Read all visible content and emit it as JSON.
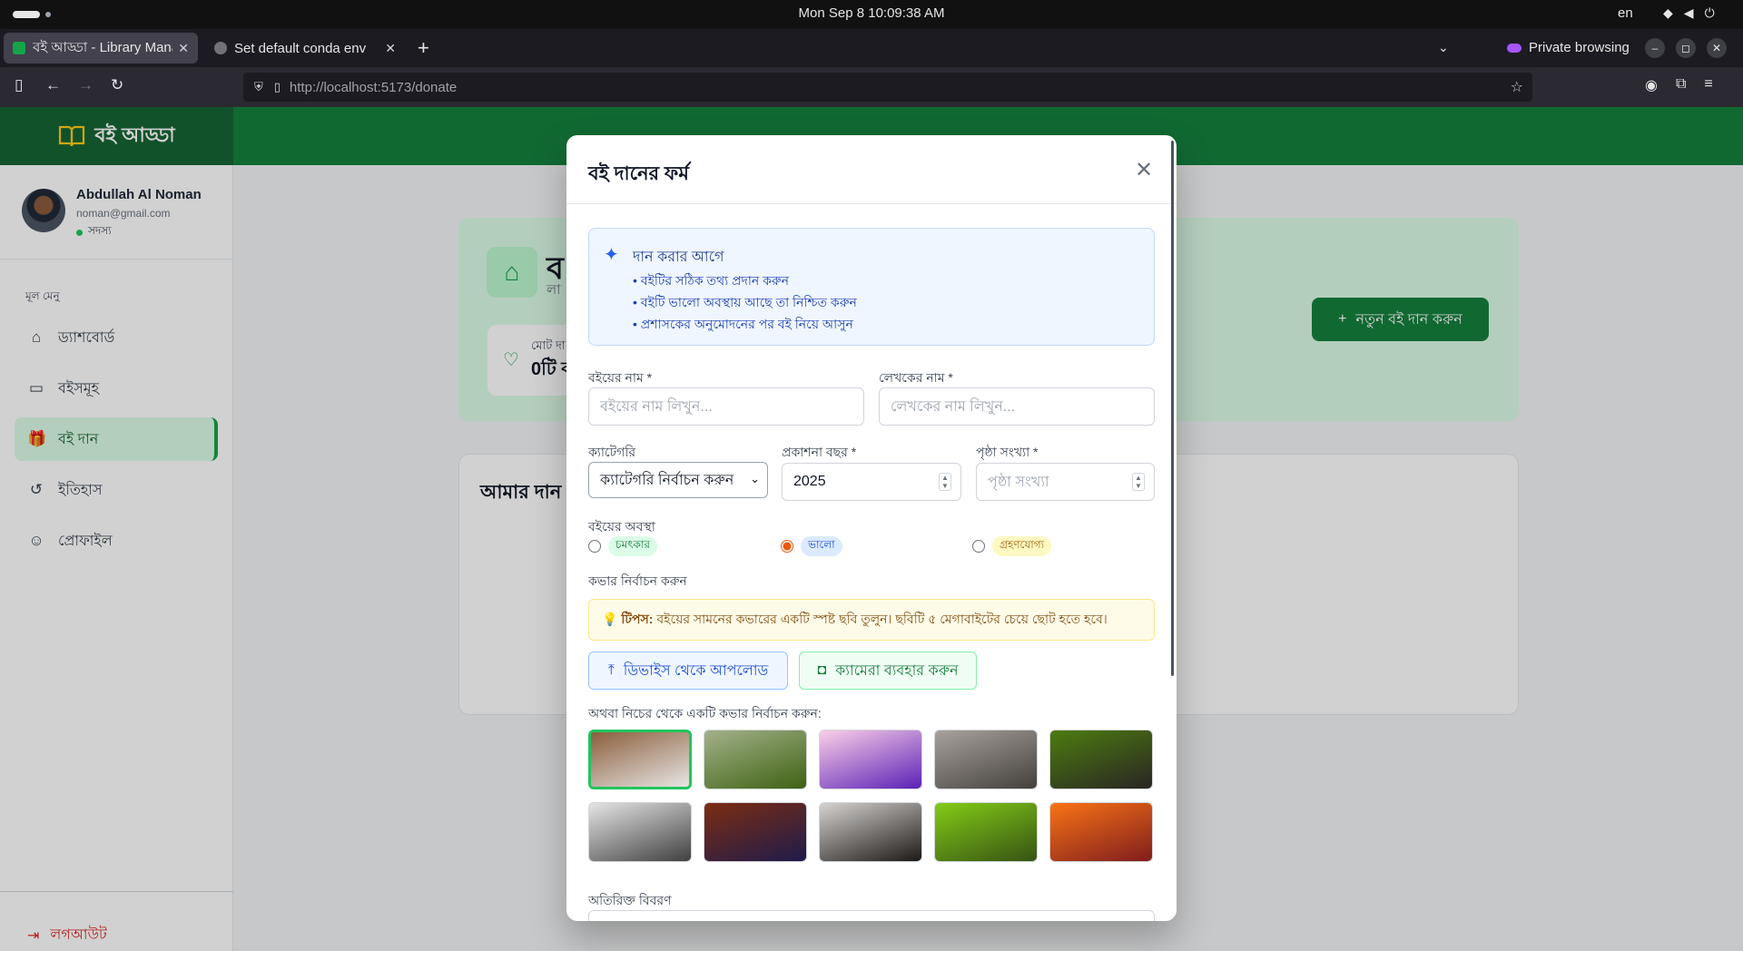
{
  "os": {
    "clock": "Mon Sep 8  10:09:38 AM",
    "lang": "en"
  },
  "browser": {
    "tabs": [
      {
        "title": "বই আড্ডা - Library Manager",
        "active": true
      },
      {
        "title": "Set default conda env",
        "active": false
      }
    ],
    "private_label": "Private browsing",
    "url_host": "http://localhost",
    "url_path": ":5173/donate"
  },
  "app": {
    "brand": "বই আড্ডা",
    "user": {
      "name": "Abdullah Al Noman",
      "email": "noman@gmail.com",
      "role": "সদস্য"
    },
    "menu_heading": "মূল মেনু",
    "menu": [
      {
        "label": "ড্যাশবোর্ড",
        "icon": "home-icon",
        "glyph": "⌂"
      },
      {
        "label": "বইসমূহ",
        "icon": "book-icon",
        "glyph": "▭"
      },
      {
        "label": "বই দান",
        "icon": "gift-icon",
        "glyph": "🎁"
      },
      {
        "label": "ইতিহাস",
        "icon": "history-icon",
        "glyph": "↺"
      },
      {
        "label": "প্রোফাইল",
        "icon": "user-icon",
        "glyph": "☺"
      }
    ],
    "active_menu_index": 2,
    "logout_label": "লগআউট",
    "hero_title": "ব",
    "hero_sub": "লা",
    "stat_label": "মোট দা",
    "stat_value": "0টি ব",
    "donate_button": "নতুন বই দান করুন",
    "list_title": "আমার দান"
  },
  "modal": {
    "title": "বই দানের ফর্ম",
    "info": {
      "title": "দান করার আগে",
      "lines": [
        "• বইটির সঠিক তথ্য প্রদান করুন",
        "• বইটি ভালো অবস্থায় আছে তা নিশ্চিত করুন",
        "• প্রশাসকের অনুমোদনের পর বই নিয়ে আসুন"
      ]
    },
    "book_name_label": "বইয়ের নাম *",
    "book_name_placeholder": "বইয়ের নাম লিখুন...",
    "author_label": "লেখকের নাম *",
    "author_placeholder": "লেখকের নাম লিখুন...",
    "category_label": "ক্যাটেগরি",
    "category_value": "ক্যাটেগরি নির্বাচন করুন",
    "year_label": "প্রকাশনা বছর *",
    "year_value": "2025",
    "pages_label": "পৃষ্ঠা সংখ্যা *",
    "pages_placeholder": "পৃষ্ঠা সংখ্যা",
    "condition_label": "বইয়ের অবস্থা",
    "conditions": [
      {
        "label": "চমৎকার",
        "checked": false
      },
      {
        "label": "ভালো",
        "checked": true
      },
      {
        "label": "গ্রহণযোগ্য",
        "checked": false
      }
    ],
    "cover_label": "কভার নির্বাচন করুন",
    "tip_bold": "💡 টিপস:",
    "tip_text": "বইয়ের সামনের কভারের একটি স্পষ্ট ছবি তুলুন। ছবিটি ৫ মেগাবাইটের চেয়ে ছোট হতে হবে।",
    "upload_device": "ডিভাইস থেকে আপলোড",
    "upload_camera": "ক্যামেরা ব্যবহার করুন",
    "or_label": "অথবা নিচের থেকে একটি কভার নির্বাচন করুন:",
    "covers": [
      {
        "name": "cover-chairs",
        "selected": true,
        "colors": [
          "#8b5e3c",
          "#e7e5e4"
        ]
      },
      {
        "name": "cover-mountains",
        "selected": false,
        "colors": [
          "#a3b18a",
          "#3f6212"
        ]
      },
      {
        "name": "cover-blossom",
        "selected": false,
        "colors": [
          "#fbcfe8",
          "#5b21b6"
        ]
      },
      {
        "name": "cover-city-shoes",
        "selected": false,
        "colors": [
          "#a8a29e",
          "#44403c"
        ]
      },
      {
        "name": "cover-vehicle",
        "selected": false,
        "colors": [
          "#4d7c0f",
          "#292524"
        ]
      },
      {
        "name": "cover-lighthouse",
        "selected": false,
        "colors": [
          "#e5e5e5",
          "#404040"
        ]
      },
      {
        "name": "cover-galaxy",
        "selected": false,
        "colors": [
          "#7c2d12",
          "#1e1b4b"
        ]
      },
      {
        "name": "cover-coffee",
        "selected": false,
        "colors": [
          "#d6d3d1",
          "#1c1917"
        ]
      },
      {
        "name": "cover-forest",
        "selected": false,
        "colors": [
          "#84cc16",
          "#365314"
        ]
      },
      {
        "name": "cover-sunset",
        "selected": false,
        "colors": [
          "#f97316",
          "#7f1d1d"
        ]
      }
    ],
    "description_label": "অতিরিক্ত বিবরণ"
  },
  "colors": {
    "brand": "#15803d",
    "brand_dark": "#166534",
    "accent_radio": "#ea580c"
  }
}
